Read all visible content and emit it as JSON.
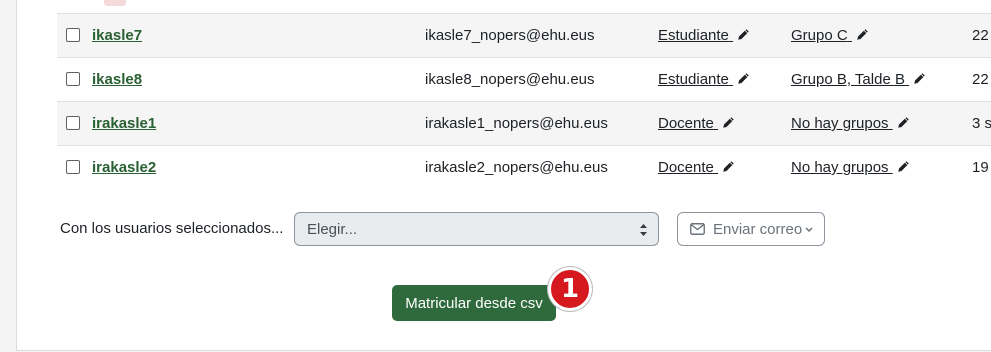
{
  "rows": [
    {
      "username": "ikasle7",
      "email": "ikasle7_nopers@ehu.eus",
      "role": "Estudiante",
      "groups": "Grupo C",
      "access": "22",
      "striped": true
    },
    {
      "username": "ikasle8",
      "email": "ikasle8_nopers@ehu.eus",
      "role": "Estudiante",
      "groups": "Grupo B, Talde B",
      "access": "22",
      "striped": false
    },
    {
      "username": "irakasle1",
      "email": "irakasle1_nopers@ehu.eus",
      "role": "Docente",
      "groups": "No hay grupos",
      "access": "3 s",
      "striped": true
    },
    {
      "username": "irakasle2",
      "email": "irakasle2_nopers@ehu.eus",
      "role": "Docente",
      "groups": "No hay grupos",
      "access": "19",
      "striped": false
    }
  ],
  "bulk": {
    "label": "Con los usuarios seleccionados...",
    "select_value": "Elegir...",
    "send_mail_label": "Enviar correo"
  },
  "enrol_button_label": "Matricular desde csv",
  "step_badge": "1",
  "icons": {
    "pencil": "pencil-icon",
    "envelope": "envelope-icon",
    "select_arrows": "select-arrows-icon",
    "caret": "chevron-down-icon"
  },
  "colors": {
    "link_green": "#296133",
    "primary_button": "#2f6a3d",
    "badge_red": "#d6191f"
  }
}
